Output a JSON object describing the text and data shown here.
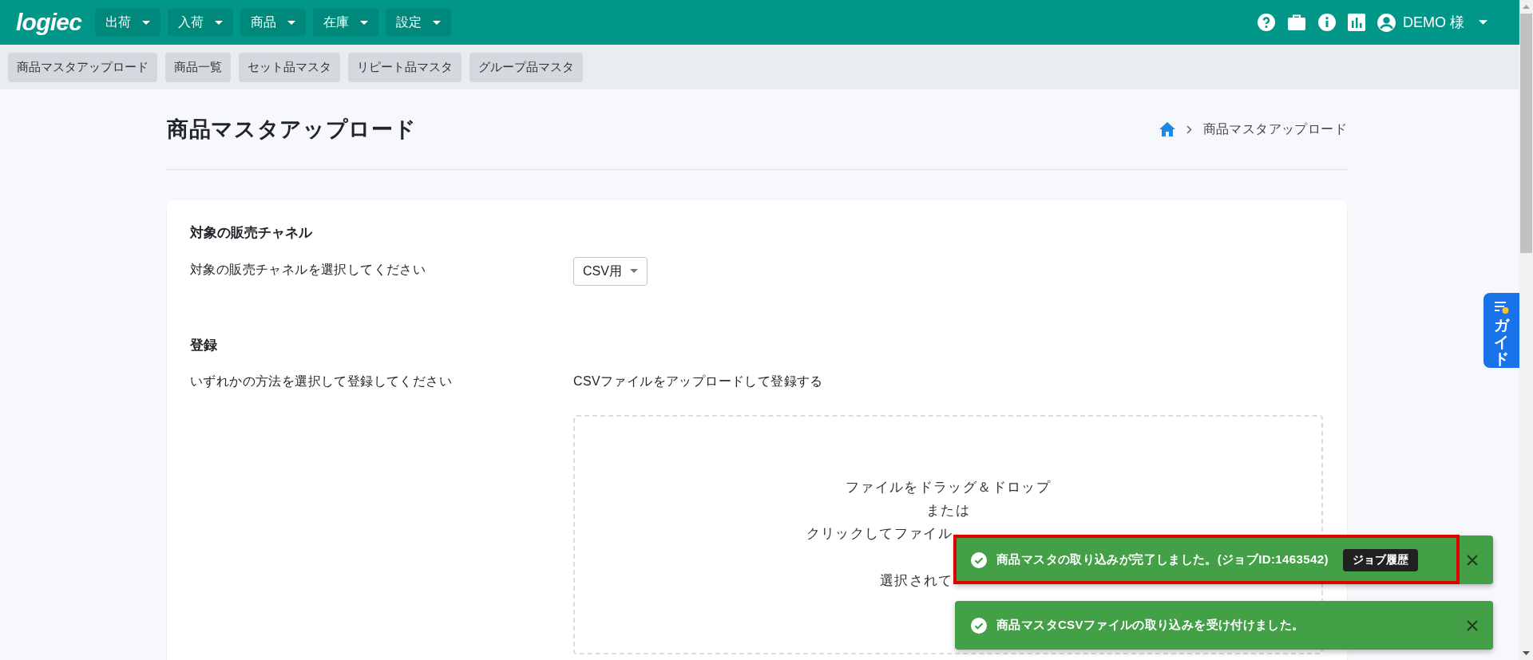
{
  "app": {
    "logo": "logiec"
  },
  "nav_menus": [
    {
      "label": "出荷"
    },
    {
      "label": "入荷"
    },
    {
      "label": "商品"
    },
    {
      "label": "在庫"
    },
    {
      "label": "設定"
    }
  ],
  "user": {
    "name": "DEMO 様"
  },
  "sub_tabs": [
    {
      "label": "商品マスタアップロード"
    },
    {
      "label": "商品一覧"
    },
    {
      "label": "セット品マスタ"
    },
    {
      "label": "リピート品マスタ"
    },
    {
      "label": "グループ品マスタ"
    }
  ],
  "page": {
    "title": "商品マスタアップロード",
    "breadcrumb": [
      "商品マスタアップロード"
    ]
  },
  "sections": [
    {
      "heading": "対象の販売チャネル",
      "label": "対象の販売チャネルを選択してください",
      "kind": "select",
      "value": "CSV用"
    },
    {
      "heading": "登録",
      "label": "いずれかの方法を選択して登録してください",
      "kind": "upload",
      "method": "CSVファイルをアップロードして登録する",
      "prompt_lines": [
        {
          "text": "ファイルをドラッグ＆ドロップ",
          "kind": "full"
        },
        {
          "text": "または",
          "kind": "full"
        },
        {
          "text": "クリックしてファイル",
          "kind": "cut"
        }
      ],
      "file_status": "選択されて"
    }
  ],
  "toasts": [
    {
      "message": "商品マスタの取り込みが完了しました。(ジョブID:1463542)",
      "action": "ジョブ履歴",
      "highlighted": true
    },
    {
      "message": "商品マスタCSVファイルの取り込みを受け付けました。",
      "highlighted": false
    }
  ],
  "guide_tab": {
    "label": "ガイド"
  }
}
